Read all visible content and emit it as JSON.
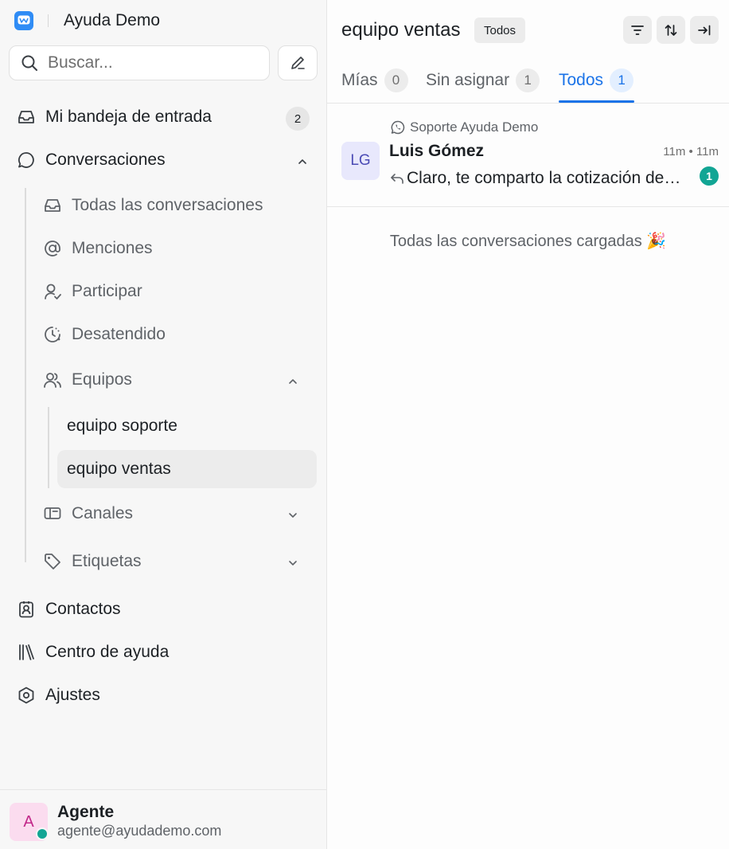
{
  "brand": {
    "name": "Ayuda Demo"
  },
  "search": {
    "placeholder": "Buscar..."
  },
  "sidebar": {
    "inbox": {
      "label": "Mi bandeja de entrada",
      "count": "2"
    },
    "conversations": {
      "label": "Conversaciones",
      "items": [
        {
          "label": "Todas las conversaciones",
          "icon": "inbox-icon"
        },
        {
          "label": "Menciones",
          "icon": "at-icon"
        },
        {
          "label": "Participar",
          "icon": "user-check-icon"
        },
        {
          "label": "Desatendido",
          "icon": "clock-icon"
        }
      ],
      "teams": {
        "label": "Equipos",
        "items": [
          {
            "label": "equipo soporte"
          },
          {
            "label": "equipo ventas"
          }
        ]
      },
      "channels": {
        "label": "Canales"
      },
      "labels": {
        "label": "Etiquetas"
      }
    },
    "contacts": {
      "label": "Contactos"
    },
    "help_center": {
      "label": "Centro de ayuda"
    },
    "settings": {
      "label": "Ajustes"
    }
  },
  "user": {
    "initial": "A",
    "name": "Agente",
    "email": "agente@ayudademo.com",
    "status_color": "#12a594"
  },
  "main": {
    "title": "equipo ventas",
    "filter_pill": "Todos",
    "tabs": [
      {
        "label": "Mías",
        "count": "0"
      },
      {
        "label": "Sin asignar",
        "count": "1"
      },
      {
        "label": "Todos",
        "count": "1",
        "active": true
      }
    ],
    "conversation": {
      "inbox": "Soporte Ayuda Demo",
      "initials": "LG",
      "name": "Luis Gómez",
      "time": "11m • 11m",
      "message": "Claro, te comparto la cotización del plan anual",
      "unread": "1"
    },
    "loaded_message": "Todas las conversaciones cargadas 🎉"
  },
  "colors": {
    "accent": "#1a73e8",
    "brand": "#2f8cf5",
    "unread": "#12a594"
  }
}
